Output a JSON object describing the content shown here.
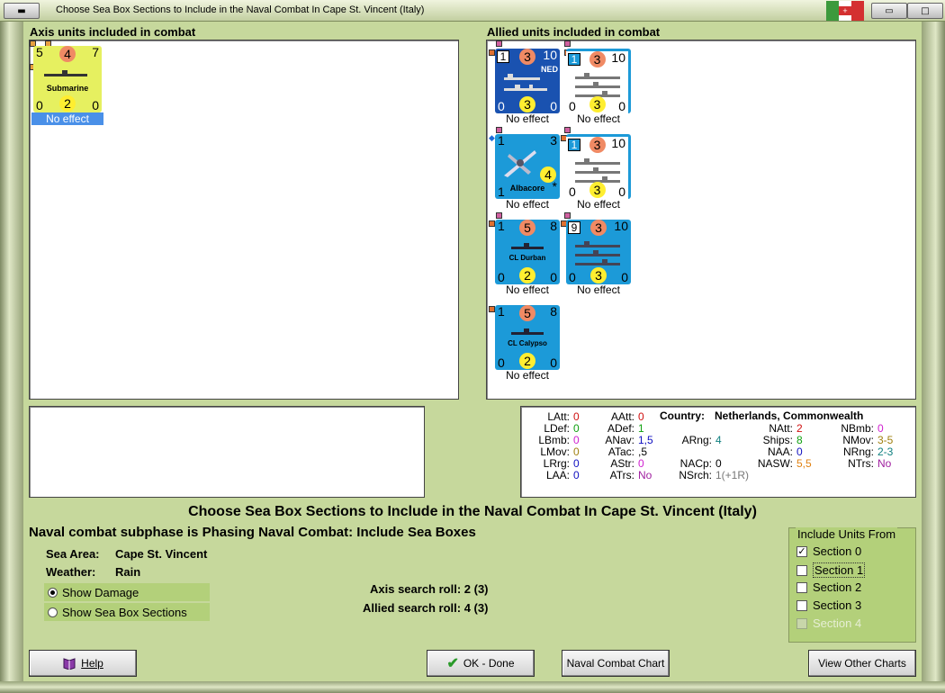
{
  "window": {
    "title": "Choose Sea Box Sections to Include in the Naval Combat In Cape St. Vincent (Italy)",
    "flag_colors": [
      "#3c9a3c",
      "#ffffff",
      "#d43030"
    ]
  },
  "axis_panel": {
    "header": "Axis units included in combat",
    "units": [
      {
        "top_left": "5",
        "top_center": "4",
        "top_right": "7",
        "name": "Submarine",
        "bottom_left": "0",
        "bottom_center": "2",
        "bottom_right": "0",
        "effect": "No effect",
        "bg": "#e6f060"
      }
    ]
  },
  "allied_panel": {
    "header": "Allied units included in combat",
    "units": [
      {
        "top_left": "1",
        "top_center": "3",
        "top_right": "10",
        "tag": "NED",
        "bottom_left": "0",
        "bottom_center": "3",
        "bottom_right": "0",
        "effect": "No effect",
        "bg": "#1a52b0"
      },
      {
        "top_left": "1",
        "top_center": "3",
        "top_right": "10",
        "bottom_left": "0",
        "bottom_center": "3",
        "bottom_right": "0",
        "effect": "No effect",
        "bg": "#ffffff"
      },
      {
        "top_left": "1",
        "top_right": "3",
        "center_value": "4",
        "name": "Albacore",
        "bottom_left": "1",
        "star": "*",
        "effect": "No effect",
        "bg": "#1c9ad8"
      },
      {
        "top_left": "1",
        "top_center": "3",
        "top_right": "10",
        "bottom_left": "0",
        "bottom_center": "3",
        "bottom_right": "0",
        "effect": "No effect",
        "bg": "#ffffff"
      },
      {
        "top_left": "1",
        "top_center": "5",
        "top_right": "8",
        "name": "CL Durban",
        "bottom_left": "0",
        "bottom_center": "2",
        "bottom_right": "0",
        "effect": "No effect",
        "bg": "#1c9ad8"
      },
      {
        "top_left": "9",
        "top_center": "3",
        "top_right": "10",
        "bottom_left": "0",
        "bottom_center": "3",
        "bottom_right": "0",
        "effect": "No effect",
        "bg": "#1c9ad8"
      },
      {
        "top_left": "1",
        "top_center": "5",
        "top_right": "8",
        "name": "CL Calypso",
        "bottom_left": "0",
        "bottom_center": "2",
        "bottom_right": "0",
        "effect": "No effect",
        "bg": "#1c9ad8"
      }
    ]
  },
  "stats": {
    "LAtt": "0",
    "LDef": "0",
    "LBmb": "0",
    "LMov": "0",
    "LRrg": "0",
    "LAA": "0",
    "AAtt": "0",
    "ADef": "1",
    "ANav": "1,5",
    "ATac": ",5",
    "AStr": "0",
    "ATrs": "No",
    "country_label": "Country:",
    "country_value": "Netherlands, Commonwealth",
    "ARng": "4",
    "NACp": "0",
    "NSrch": "1(+1R)",
    "NAtt": "2",
    "Ships": "8",
    "NAA": "0",
    "NASW": "5,5",
    "NBmb": "0",
    "NMov": "3-5",
    "NRng": "2-3",
    "NTrs": "No"
  },
  "main": {
    "heading": "Choose Sea Box Sections to Include in the Naval Combat In Cape St. Vincent (Italy)",
    "subphase": "Naval combat subphase is Phasing Naval Combat: Include Sea Boxes",
    "sea_area_label": "Sea Area:",
    "sea_area_value": "Cape St. Vincent",
    "weather_label": "Weather:",
    "weather_value": "Rain",
    "show_damage": "Show Damage",
    "show_sections": "Show Sea Box Sections",
    "axis_roll": "Axis search roll: 2 (3)",
    "allied_roll": "Allied search roll: 4 (3)"
  },
  "include": {
    "title": "Include Units From",
    "sections": [
      {
        "label": "Section 0",
        "checked": true,
        "enabled": true
      },
      {
        "label": "Section 1",
        "checked": false,
        "enabled": true
      },
      {
        "label": "Section 2",
        "checked": false,
        "enabled": true
      },
      {
        "label": "Section 3",
        "checked": false,
        "enabled": true
      },
      {
        "label": "Section 4",
        "checked": false,
        "enabled": false
      }
    ]
  },
  "buttons": {
    "help": "Help",
    "ok": "OK - Done",
    "naval_chart": "Naval Combat Chart",
    "other_charts": "View Other Charts"
  }
}
